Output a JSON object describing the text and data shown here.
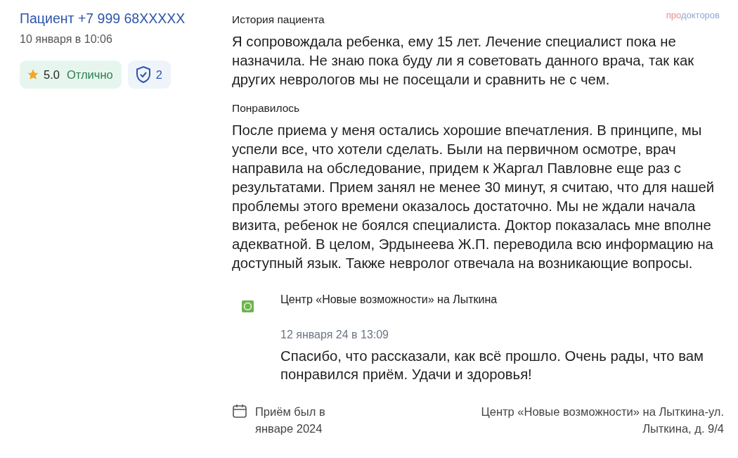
{
  "author": {
    "name": "Пациент +7 999 68XXXXX",
    "date": "10 января в 10:06"
  },
  "rating": {
    "score": "5.0",
    "verdict": "Отлично"
  },
  "verified": {
    "count": "2"
  },
  "logo": {
    "prefix": "про",
    "rest": "докторов"
  },
  "sections": [
    {
      "title": "История пациента",
      "text": "Я сопровождала ребенка, ему 15 лет. Лечение специалист пока не назначила. Не знаю пока буду ли я советовать данного врача, так как других неврологов мы не посещали и сравнить не с чем."
    },
    {
      "title": "Понравилось",
      "text": "После приема у меня остались хорошие впечатления. В принципе, мы успели все, что хотели сделать. Были на первичном осмотре, врач направила на обследование, придем к Жаргал Павловне еще раз с результатами. Прием занял не менее 30 минут, я считаю, что для нашей проблемы этого времени оказалось достаточно. Мы не ждали начала визита, ребенок не боялся специалиста. Доктор показалась мне вполне адекватной. В целом, Эрдынеева Ж.П. переводила всю информацию на доступный язык. Также невролог отвечала на возникающие вопросы."
    }
  ],
  "reply": {
    "org": "Центр «Новые возможности» на Лыткина",
    "date": "12 января 24 в 13:09",
    "text": "Спасибо, что рассказали, как всё прошло. Очень рады, что вам понравился приём. Удачи и здоровья!"
  },
  "footer": {
    "visit": "Приём был в январе 2024",
    "clinic": "Центр «Новые возможности» на Лыткина-ул. Лыткина, д. 9/4"
  }
}
